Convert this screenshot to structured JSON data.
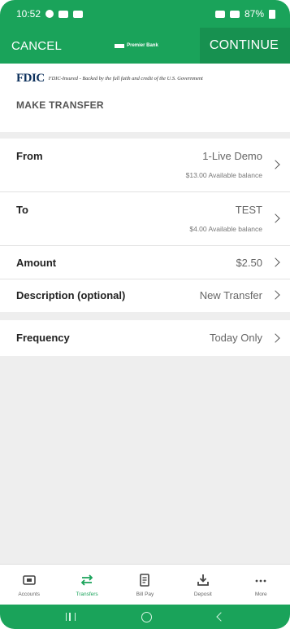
{
  "status_bar": {
    "time": "10:52",
    "battery": "87%"
  },
  "header": {
    "cancel_label": "CANCEL",
    "logo_text": "Premier Bank",
    "continue_label": "CONTINUE"
  },
  "fdic": {
    "logo": "FDIC",
    "text": "FDIC-Insured - Backed by the full faith and credit of the U.S. Government"
  },
  "page_title": "MAKE TRANSFER",
  "form": {
    "from": {
      "label": "From",
      "value": "1-Live Demo",
      "sub": "$13.00 Available balance"
    },
    "to": {
      "label": "To",
      "value": "TEST",
      "sub": "$4.00 Available balance"
    },
    "amount": {
      "label": "Amount",
      "value": "$2.50"
    },
    "description": {
      "label": "Description (optional)",
      "value": "New Transfer"
    },
    "frequency": {
      "label": "Frequency",
      "value": "Today Only"
    }
  },
  "tabs": [
    {
      "label": "Accounts",
      "icon": "accounts-icon",
      "active": false
    },
    {
      "label": "Transfers",
      "icon": "transfers-icon",
      "active": true
    },
    {
      "label": "Bill Pay",
      "icon": "bill-pay-icon",
      "active": false
    },
    {
      "label": "Deposit",
      "icon": "deposit-icon",
      "active": false
    },
    {
      "label": "More",
      "icon": "more-icon",
      "active": false
    }
  ],
  "colors": {
    "brand": "#1aa35a",
    "brand_dark": "#179150",
    "fdic_navy": "#0b2f5b"
  }
}
